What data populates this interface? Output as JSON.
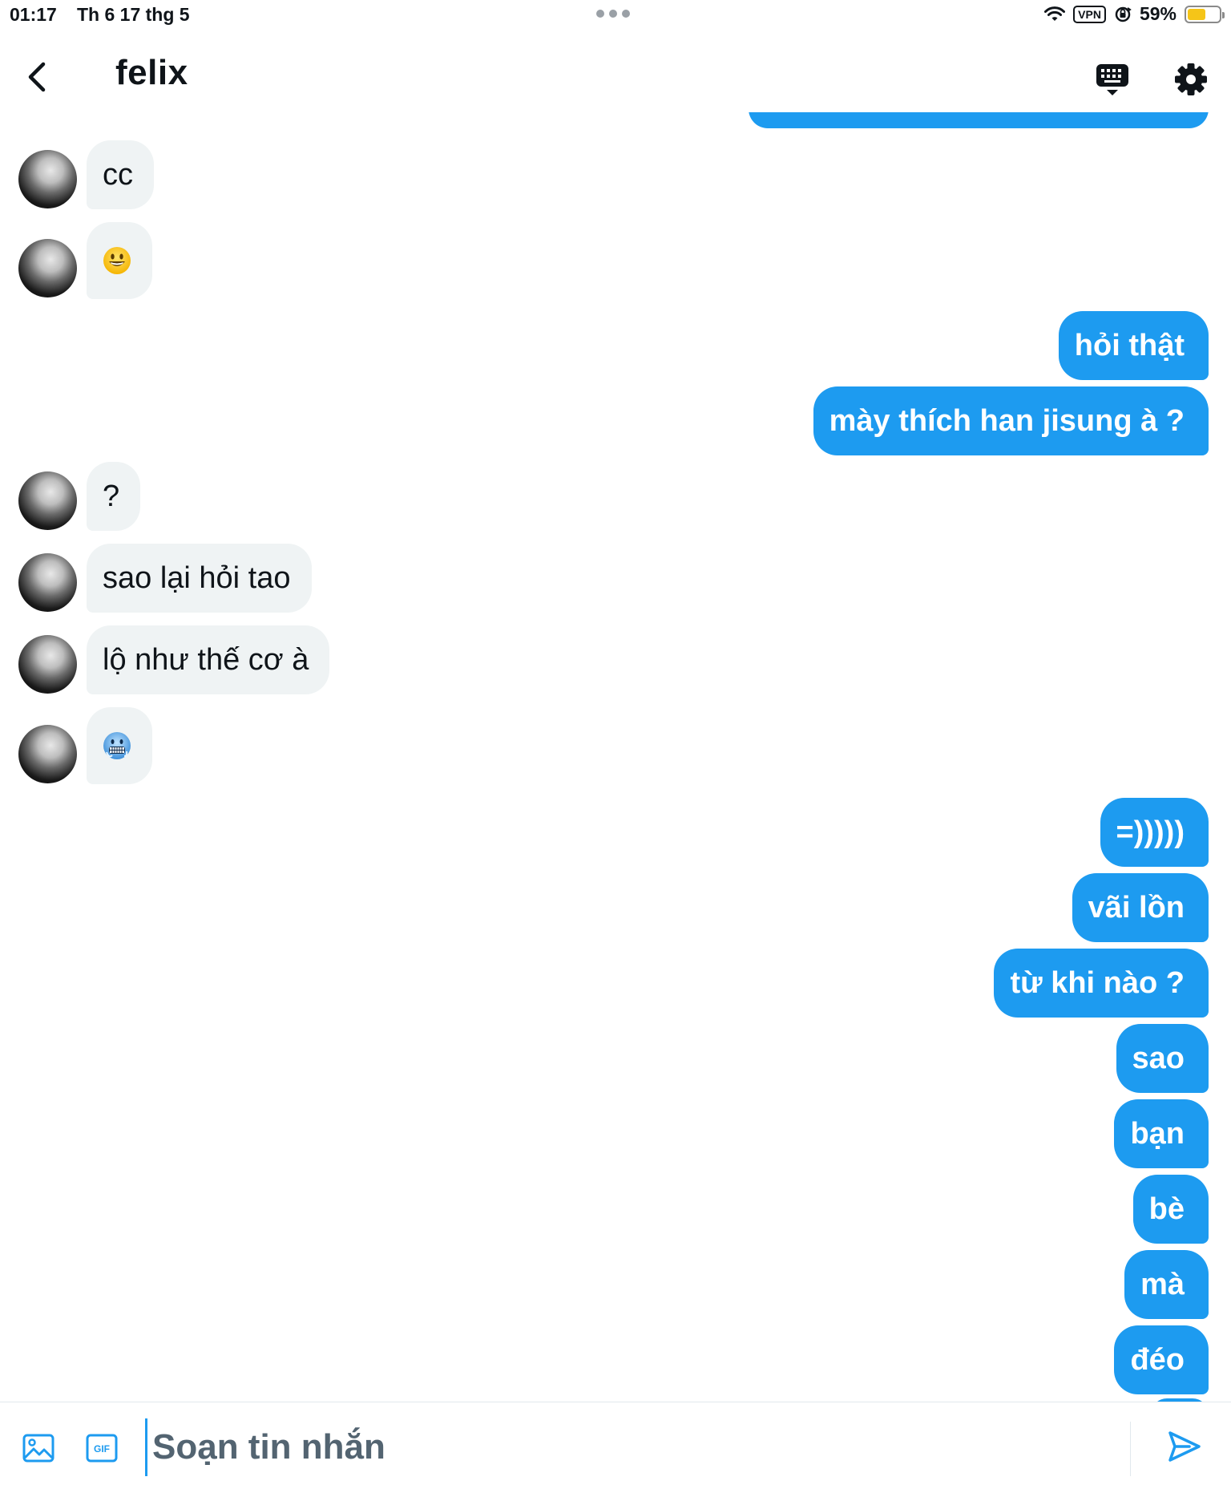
{
  "status_bar": {
    "time": "01:17",
    "date": "Th 6 17 thg 5",
    "vpn": "VPN",
    "battery": "59%",
    "battery_level": 0.59
  },
  "header": {
    "title": "felix"
  },
  "messages": [
    {
      "side": "in",
      "text": "cc"
    },
    {
      "side": "in",
      "emoji": "grinning-face"
    },
    {
      "side": "out",
      "text": "hỏi thật"
    },
    {
      "side": "out",
      "text": "mày thích han jisung à ?"
    },
    {
      "side": "in",
      "text": "?"
    },
    {
      "side": "in",
      "text": "sao lại hỏi tao"
    },
    {
      "side": "in",
      "text": "lộ như thế cơ à"
    },
    {
      "side": "in",
      "emoji": "cold-face"
    },
    {
      "side": "out",
      "text": "=)))))"
    },
    {
      "side": "out",
      "text": "vãi lồn"
    },
    {
      "side": "out",
      "text": "từ khi nào ?"
    },
    {
      "side": "out",
      "text": "sao"
    },
    {
      "side": "out",
      "text": "bạn"
    },
    {
      "side": "out",
      "text": "bè"
    },
    {
      "side": "out",
      "text": "mà"
    },
    {
      "side": "out",
      "text": "đéo"
    }
  ],
  "composer": {
    "placeholder": "Soạn tin nhắn"
  },
  "colors": {
    "accent": "#1d9bf0",
    "incoming_bubble": "#eff3f4",
    "text_primary": "#0f1419",
    "text_secondary": "#536471"
  }
}
